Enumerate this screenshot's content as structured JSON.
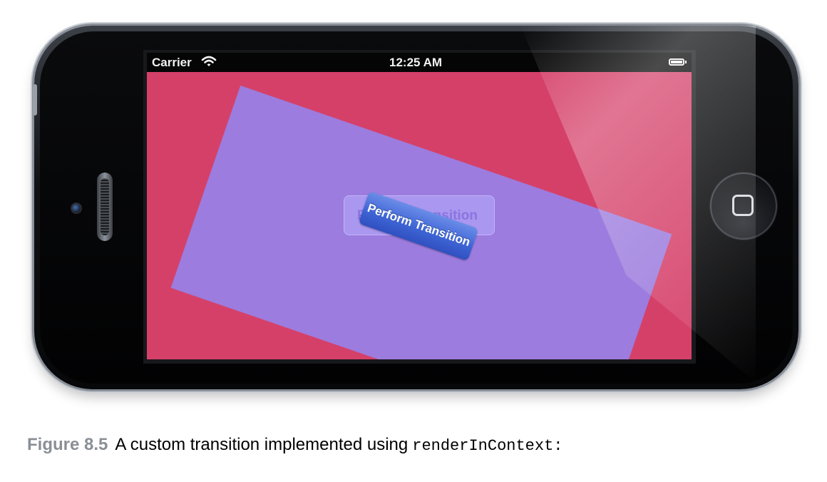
{
  "status_bar": {
    "carrier": "Carrier",
    "wifi_icon": "wifi-icon",
    "time": "12:25 AM",
    "battery_icon": "battery-icon"
  },
  "app": {
    "background_color": "#d54069",
    "snapshot_color": "#9b7de0",
    "button_label": "Perform Transition",
    "button_color": "#3f66d6"
  },
  "caption": {
    "label": "Figure 8.5",
    "text": "A custom transition implemented using",
    "code": "renderInContext:"
  }
}
